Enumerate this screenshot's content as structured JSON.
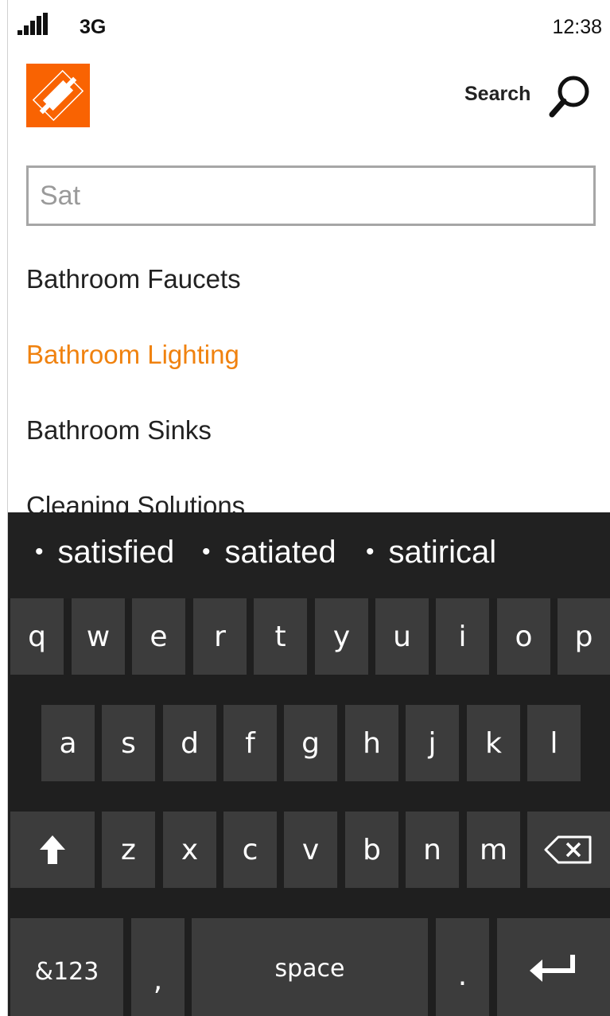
{
  "status_bar": {
    "network": "3G",
    "time": "12:38"
  },
  "header": {
    "logo_alt": "THE HOME DEPOT",
    "search_label": "Search"
  },
  "search": {
    "value": "Sat"
  },
  "suggestions": [
    "Bathroom Faucets",
    "Bathroom Lighting",
    "Bathroom Sinks",
    "Cleaning Solutions"
  ],
  "word_suggestions": [
    "satisfied",
    "satiated",
    "satirical"
  ],
  "keyboard": {
    "row1": [
      "q",
      "w",
      "e",
      "r",
      "t",
      "y",
      "u",
      "i",
      "o",
      "p"
    ],
    "row2": [
      "a",
      "s",
      "d",
      "f",
      "g",
      "h",
      "j",
      "k",
      "l"
    ],
    "row3": [
      "z",
      "x",
      "c",
      "v",
      "b",
      "n",
      "m"
    ],
    "symbols_label": "&123",
    "comma_label": ",",
    "space_label": "space",
    "period_label": "."
  },
  "colors": {
    "brand_orange": "#f96302",
    "highlight": "#f0820f",
    "key_bg": "#3c3c3c",
    "keyboard_bg": "#1f1f1f"
  }
}
